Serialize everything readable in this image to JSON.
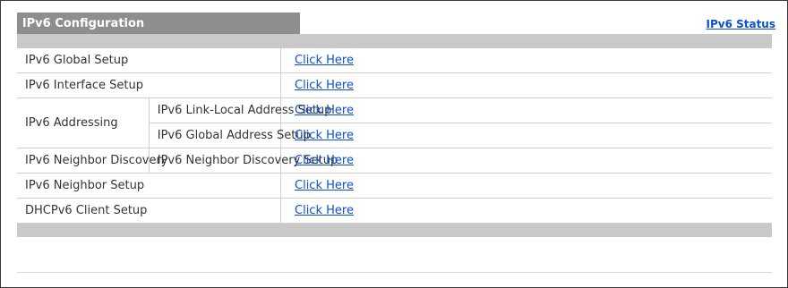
{
  "tab": {
    "label": "IPv6 Configuration"
  },
  "header_link": "IPv6 Status",
  "rows": [
    {
      "label": "IPv6 Global Setup",
      "sublabel": "",
      "link": "Click Here"
    },
    {
      "label": "IPv6 Interface Setup",
      "sublabel": "",
      "link": "Click Here"
    },
    {
      "label": "IPv6 Addressing",
      "sublabel": "IPv6 Link-Local Address Setup",
      "link": "Click Here"
    },
    {
      "label": "",
      "sublabel": "IPv6 Global Address Setup",
      "link": "Click Here"
    },
    {
      "label": "IPv6 Neighbor Discovery",
      "sublabel": "IPv6 Neighbor Discovery Setup",
      "link": "Click Here"
    },
    {
      "label": "IPv6 Neighbor Setup",
      "sublabel": "",
      "link": "Click Here"
    },
    {
      "label": "DHCPv6 Client Setup",
      "sublabel": "",
      "link": "Click Here"
    }
  ],
  "colors": {
    "link": "#0b4fd6",
    "tab_bg": "#8e8e8e",
    "bar_bg": "#c9c9c9"
  }
}
